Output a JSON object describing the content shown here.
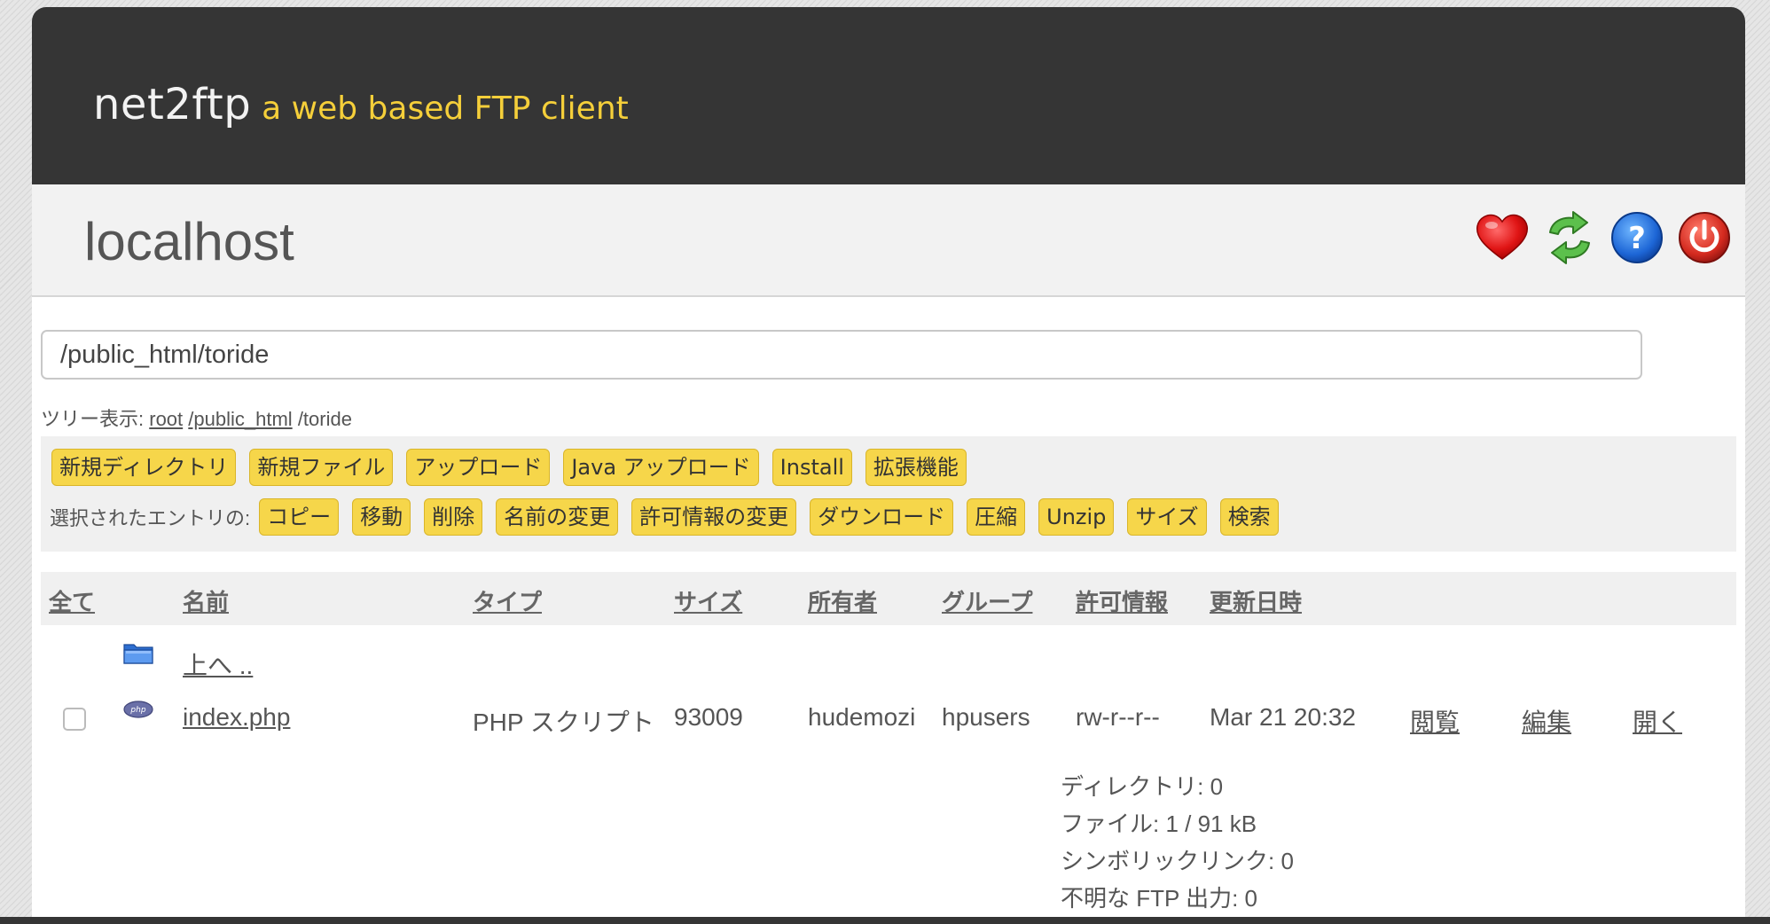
{
  "header": {
    "brand_name": "net2ftp",
    "brand_tagline": "a web based FTP client"
  },
  "host": {
    "title": "localhost",
    "icons": [
      "heart-icon",
      "refresh-icon",
      "help-icon",
      "power-icon"
    ]
  },
  "path": {
    "value": "/public_html/toride"
  },
  "tree": {
    "label": "ツリー表示:",
    "root": "root",
    "public_html": "/public_html",
    "current": "/toride"
  },
  "toolbar": {
    "row1": [
      "新規ディレクトリ",
      "新規ファイル",
      "アップロード",
      "Java アップロード",
      "Install",
      "拡張機能"
    ],
    "selected_label": "選択されたエントリの:",
    "row2": [
      "コピー",
      "移動",
      "削除",
      "名前の変更",
      "許可情報の変更",
      "ダウンロード",
      "圧縮",
      "Unzip",
      "サイズ",
      "検索"
    ]
  },
  "columns": {
    "all": "全て",
    "name": "名前",
    "type": "タイプ",
    "size": "サイズ",
    "owner": "所有者",
    "group": "グループ",
    "perms": "許可情報",
    "modified": "更新日時"
  },
  "rows": {
    "up": {
      "label": "上へ .."
    },
    "file": {
      "name": "index.php",
      "type": "PHP スクリプト",
      "size": "93009",
      "owner": "hudemozi",
      "group": "hpusers",
      "perms": "rw-r--r--",
      "modified": "Mar 21 20:32",
      "view": "閲覧",
      "edit": "編集",
      "open": "開く",
      "icon_label": "php"
    }
  },
  "stats": {
    "dirs": "ディレクトリ: 0",
    "files": "ファイル: 1 / 91 kB",
    "symlinks": "シンボリックリンク: 0",
    "unknown": "不明な FTP 出力: 0"
  },
  "colors": {
    "topbar": "#353535",
    "tagline": "#f5cf3a",
    "button": "#f6d64a"
  }
}
